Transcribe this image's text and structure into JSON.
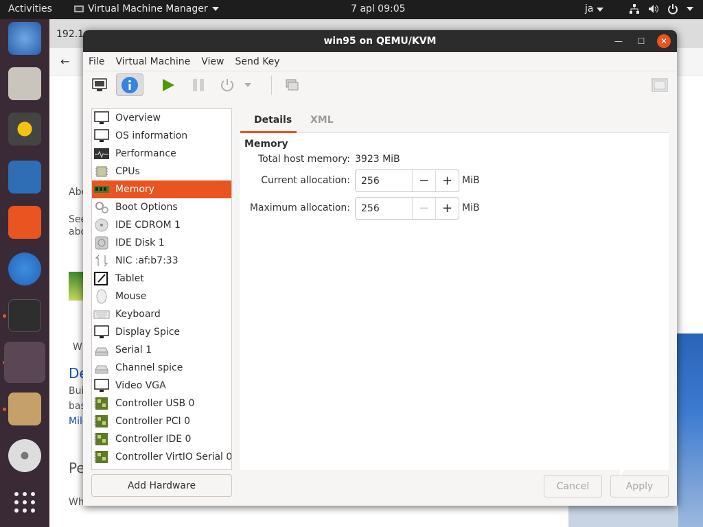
{
  "topbar": {
    "activities": "Activities",
    "app_name": "Virtual Machine Manager",
    "clock": "7 apl  09:05",
    "user": "ja"
  },
  "browser": {
    "address": "192.1",
    "side_text": [
      "Abo",
      "See",
      "abo",
      "W",
      "De",
      "Bui",
      "bas",
      "Mile",
      "Pe",
      "Wh"
    ]
  },
  "window": {
    "title": "win95 on QEMU/KVM",
    "menu": [
      "File",
      "Virtual Machine",
      "View",
      "Send Key"
    ]
  },
  "hardware": [
    {
      "label": "Overview",
      "icon": "monitor-icon"
    },
    {
      "label": "OS information",
      "icon": "monitor-icon"
    },
    {
      "label": "Performance",
      "icon": "performance-icon"
    },
    {
      "label": "CPUs",
      "icon": "cpu-icon"
    },
    {
      "label": "Memory",
      "icon": "memory-icon",
      "selected": true
    },
    {
      "label": "Boot Options",
      "icon": "gears-icon"
    },
    {
      "label": "IDE CDROM 1",
      "icon": "cdrom-icon"
    },
    {
      "label": "IDE Disk 1",
      "icon": "disk-icon"
    },
    {
      "label": "NIC :af:b7:33",
      "icon": "network-icon"
    },
    {
      "label": "Tablet",
      "icon": "tablet-icon"
    },
    {
      "label": "Mouse",
      "icon": "mouse-icon"
    },
    {
      "label": "Keyboard",
      "icon": "keyboard-icon"
    },
    {
      "label": "Display Spice",
      "icon": "monitor-icon"
    },
    {
      "label": "Serial 1",
      "icon": "serial-icon"
    },
    {
      "label": "Channel spice",
      "icon": "serial-icon"
    },
    {
      "label": "Video VGA",
      "icon": "monitor-icon"
    },
    {
      "label": "Controller USB 0",
      "icon": "controller-icon"
    },
    {
      "label": "Controller PCI 0",
      "icon": "controller-icon"
    },
    {
      "label": "Controller IDE 0",
      "icon": "controller-icon"
    },
    {
      "label": "Controller VirtIO Serial 0",
      "icon": "controller-icon"
    }
  ],
  "add_hardware": "Add Hardware",
  "details": {
    "tabs": [
      "Details",
      "XML"
    ],
    "section": "Memory",
    "total_label": "Total host memory:",
    "total_value": "3923 MiB",
    "current_label": "Current allocation:",
    "current_value": "256",
    "max_label": "Maximum allocation:",
    "max_value": "256",
    "unit": "MiB",
    "minus": "−",
    "plus": "+"
  },
  "buttons": {
    "cancel": "Cancel",
    "apply": "Apply"
  },
  "colors": {
    "accent": "#e95420",
    "titlebar": "#2c2c2c"
  }
}
